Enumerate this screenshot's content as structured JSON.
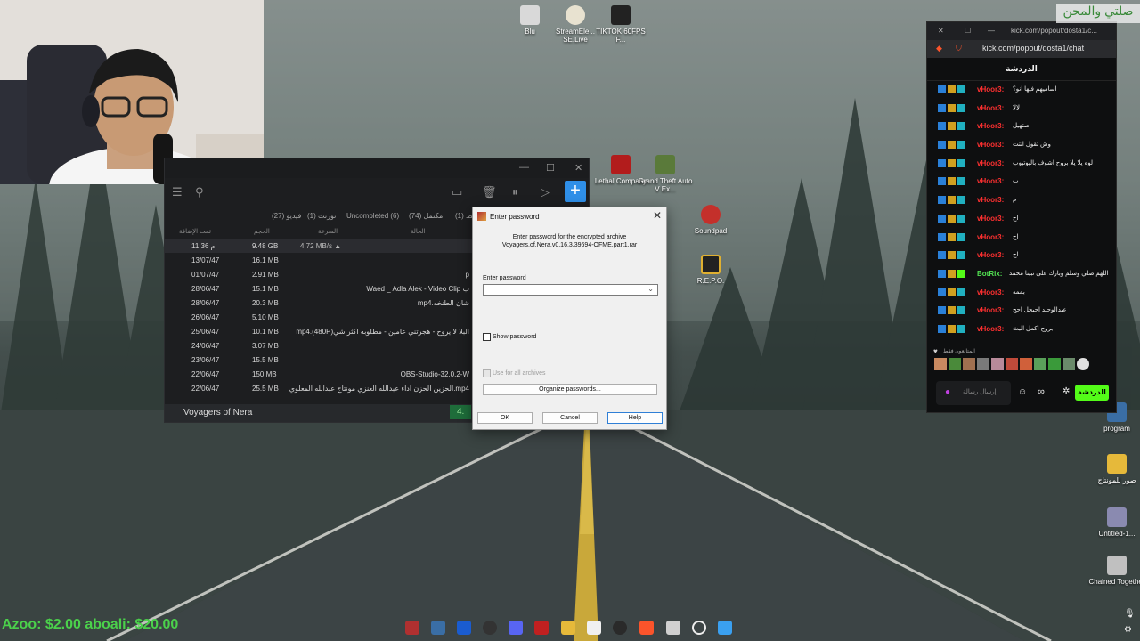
{
  "desktop_icons": [
    {
      "label": "Blu",
      "color": "#d9d9d9"
    },
    {
      "label": "StreamEle... SE.Live",
      "color": "#e8e2d0"
    },
    {
      "label": "TIKTOK 60FPS F...",
      "color": "#222222"
    },
    {
      "label": "Lethal Company",
      "color": "#b21c1c"
    },
    {
      "label": "Grand Theft Auto V Ex...",
      "color": "#5a7a3a"
    },
    {
      "label": "Soundpad",
      "color": "#c4302b"
    },
    {
      "label": "R.E.P.O.",
      "color": "#222222"
    },
    {
      "label": "program",
      "color": "#3a6ea5"
    },
    {
      "label": "صور للمونتاج",
      "color": "#e6b93a"
    },
    {
      "label": "Untitled-1...",
      "color": "#8a8ab0"
    },
    {
      "label": "Chained Together",
      "color": "#c0c0c0"
    }
  ],
  "download_manager": {
    "tabs": [
      "فيديو (27)",
      "تورنت (1)",
      "Uncompleted (6)",
      "مكتمل (74)",
      "نشط (1)"
    ],
    "columns": {
      "added": "تمت الإضافة",
      "size": "الحجم",
      "speed": "السرعة",
      "status": "الحالة"
    },
    "rows": [
      {
        "date": "11:36 م",
        "size": "9.48 GB",
        "speed": "4.72 MB/s ▲",
        "name": ""
      },
      {
        "date": "13/07/47",
        "size": "16.1 MB",
        "speed": "",
        "name": ""
      },
      {
        "date": "01/07/47",
        "size": "2.91 MB",
        "speed": "",
        "name": "p"
      },
      {
        "date": "28/06/47",
        "size": "15.1 MB",
        "speed": "",
        "name": "Waed _ Adla Alek - Video Clip ب"
      },
      {
        "date": "28/06/47",
        "size": "20.3 MB",
        "speed": "",
        "name": "mp4.شان الطنخه"
      },
      {
        "date": "26/06/47",
        "size": "5.10 MB",
        "speed": "",
        "name": ""
      },
      {
        "date": "25/06/47",
        "size": "10.1 MB",
        "speed": "",
        "name": "mp4.(480P)البلا لا يروح - هجرتني عامين - مطلوبه اكثر شي"
      },
      {
        "date": "24/06/47",
        "size": "3.07 MB",
        "speed": "",
        "name": ""
      },
      {
        "date": "23/06/47",
        "size": "15.5 MB",
        "speed": "",
        "name": ""
      },
      {
        "date": "22/06/47",
        "size": "150 MB",
        "speed": "",
        "name": "OBS-Studio-32.0.2-W"
      },
      {
        "date": "22/06/47",
        "size": "25.5 MB",
        "speed": "",
        "name": "الحزين الحزن اداء عبدالله العنزي مونتاج عبدالله المعلوي.mp4"
      }
    ],
    "status_title": "Voyagers of Nera",
    "status_badge": "4."
  },
  "password_dialog": {
    "title": "Enter password",
    "message_line1": "Enter password for the encrypted archive",
    "message_line2": "Voyagers.of.Nera.v0.16.3.39694-OFME.part1.rar",
    "field_label": "Enter password",
    "password_value": "",
    "show_password": "Show password",
    "use_all": "Use for all archives",
    "organize": "Organize passwords...",
    "ok": "OK",
    "cancel": "Cancel",
    "help": "Help"
  },
  "chat": {
    "tab_title": "kick.com/popout/dosta1/c...",
    "url": "kick.com/popout/dosta1/chat",
    "header": "الدردشة",
    "messages": [
      {
        "user": "vHoor3:",
        "text": "اساميهم فيها انو؟",
        "color": "#ff3030"
      },
      {
        "user": "vHoor3:",
        "text": "لالا",
        "color": "#ff3030"
      },
      {
        "user": "vHoor3:",
        "text": "صتهيل",
        "color": "#ff3030"
      },
      {
        "user": "vHoor3:",
        "text": "وش تقول انتت",
        "color": "#ff3030"
      },
      {
        "user": "vHoor3:",
        "text": "لوه يلا يلا بروح اشوف باليوتيوب",
        "color": "#ff3030"
      },
      {
        "user": "vHoor3:",
        "text": "ب",
        "color": "#ff3030"
      },
      {
        "user": "vHoor3:",
        "text": "م",
        "color": "#ff3030"
      },
      {
        "user": "vHoor3:",
        "text": "اح",
        "color": "#ff3030"
      },
      {
        "user": "vHoor3:",
        "text": "اح",
        "color": "#ff3030"
      },
      {
        "user": "vHoor3:",
        "text": "اح",
        "color": "#ff3030"
      },
      {
        "user": "BotRix:",
        "text": "اللهم صلي وسلم وبارك على نبينا محمد",
        "color": "#52e252"
      },
      {
        "user": "vHoor3:",
        "text": "بممه",
        "color": "#ff3030"
      },
      {
        "user": "vHoor3:",
        "text": "عبدالوحيد اجيجل احح",
        "color": "#ff3030"
      },
      {
        "user": "vHoor3:",
        "text": "بروح اكمل البث",
        "color": "#ff3030"
      }
    ],
    "supporters_label": "المتابعون فقط",
    "input_placeholder": "إرسال رسالة",
    "send_label": "الدردشة"
  },
  "taskbar": {
    "left_overlay": "Azoo: $2.00  aboali: $20.00"
  },
  "overlay_top_right": "صلتي والمحن"
}
